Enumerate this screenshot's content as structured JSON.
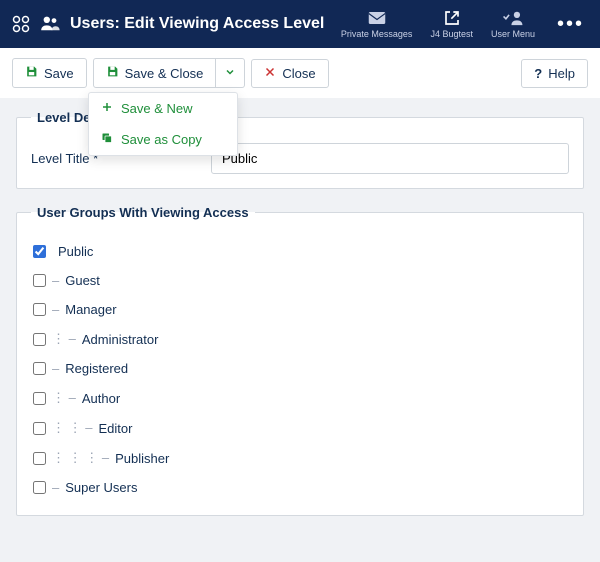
{
  "header": {
    "title": "Users: Edit Viewing Access Level",
    "nav": {
      "private_messages": "Private Messages",
      "site_name": "J4 Bugtest",
      "user_menu": "User Menu"
    }
  },
  "toolbar": {
    "save": "Save",
    "save_close": "Save & Close",
    "close": "Close",
    "help": "Help",
    "dropdown": {
      "save_new": "Save & New",
      "save_copy": "Save as Copy"
    }
  },
  "fieldsets": {
    "details": {
      "legend": "Level Details",
      "title_label": "Level Title *",
      "title_value": "Public"
    },
    "groups": {
      "legend": "User Groups With Viewing Access",
      "items": [
        {
          "label": "Public",
          "depth": 0,
          "checked": true
        },
        {
          "label": "Guest",
          "depth": 1,
          "checked": false
        },
        {
          "label": "Manager",
          "depth": 1,
          "checked": false
        },
        {
          "label": "Administrator",
          "depth": 2,
          "checked": false
        },
        {
          "label": "Registered",
          "depth": 1,
          "checked": false
        },
        {
          "label": "Author",
          "depth": 2,
          "checked": false
        },
        {
          "label": "Editor",
          "depth": 3,
          "checked": false
        },
        {
          "label": "Publisher",
          "depth": 4,
          "checked": false
        },
        {
          "label": "Super Users",
          "depth": 1,
          "checked": false
        }
      ]
    }
  }
}
